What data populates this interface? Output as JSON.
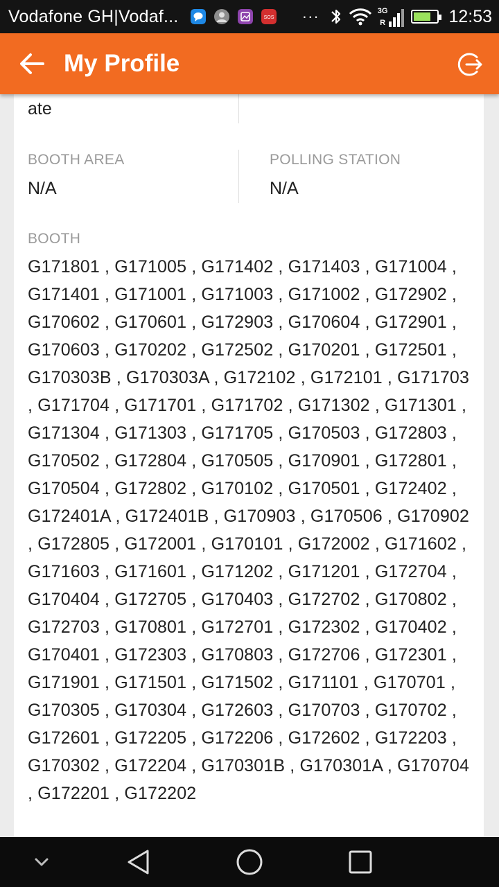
{
  "status_bar": {
    "carrier": "Vodafone GH|Vodaf...",
    "overflow": "···",
    "network": "3G",
    "network_sub": "R",
    "time": "12:53",
    "notification_icons": [
      "message-icon",
      "avatar-icon",
      "gallery-icon",
      "sos-icon"
    ],
    "battery_level": 0.75
  },
  "app_bar": {
    "title": "My Profile",
    "icons": [
      "arrow-left-icon",
      "logout-icon"
    ]
  },
  "profile": {
    "truncated_value": "ate",
    "booth_area": {
      "label": "BOOTH AREA",
      "value": "N/A"
    },
    "polling_station": {
      "label": "POLLING STATION",
      "value": "N/A"
    },
    "booth": {
      "label": "BOOTH",
      "value": "G171801 , G171005 , G171402 , G171403 , G171004 , G171401 , G171001 , G171003 , G171002 , G172902 , G170602 , G170601 , G172903 , G170604 , G172901 , G170603 , G170202 , G172502 , G170201 , G172501 , G170303B , G170303A , G172102 , G172101 , G171703 , G171704 , G171701 , G171702 , G171302 , G171301 , G171304 , G171303 , G171705 , G170503 , G172803 , G170502 , G172804 , G170505 , G170901 , G172801 , G170504 , G172802 , G170102 , G170501 , G172402 , G172401A , G172401B , G170903 , G170506 , G170902 , G172805 , G172001 , G170101 , G172002 , G171602 , G171603 , G171601 , G171202 , G171201 , G172704 , G170404 , G172705 , G170403 , G172702 , G170802 , G172703 , G170801 , G172701 , G172302 , G170402 , G170401 , G172303 , G170803 , G172706 , G172301 , G171901 , G171501 , G171502 , G171101 , G170701 , G170305 , G170304 , G172603 , G170703 , G170702 , G172601 , G172205 , G172206 , G172602 , G172203 , G170302 , G172204 , G170301B , G170301A , G170704 , G172201 , G172202"
    }
  },
  "nav_bar": {
    "icons": [
      "chevron-down-icon",
      "back-triangle-icon",
      "home-circle-icon",
      "recents-square-icon"
    ]
  },
  "colors": {
    "accent": "#f26b21",
    "status_bar": "#141414",
    "background": "#ececec",
    "label": "#9a9a9a"
  }
}
